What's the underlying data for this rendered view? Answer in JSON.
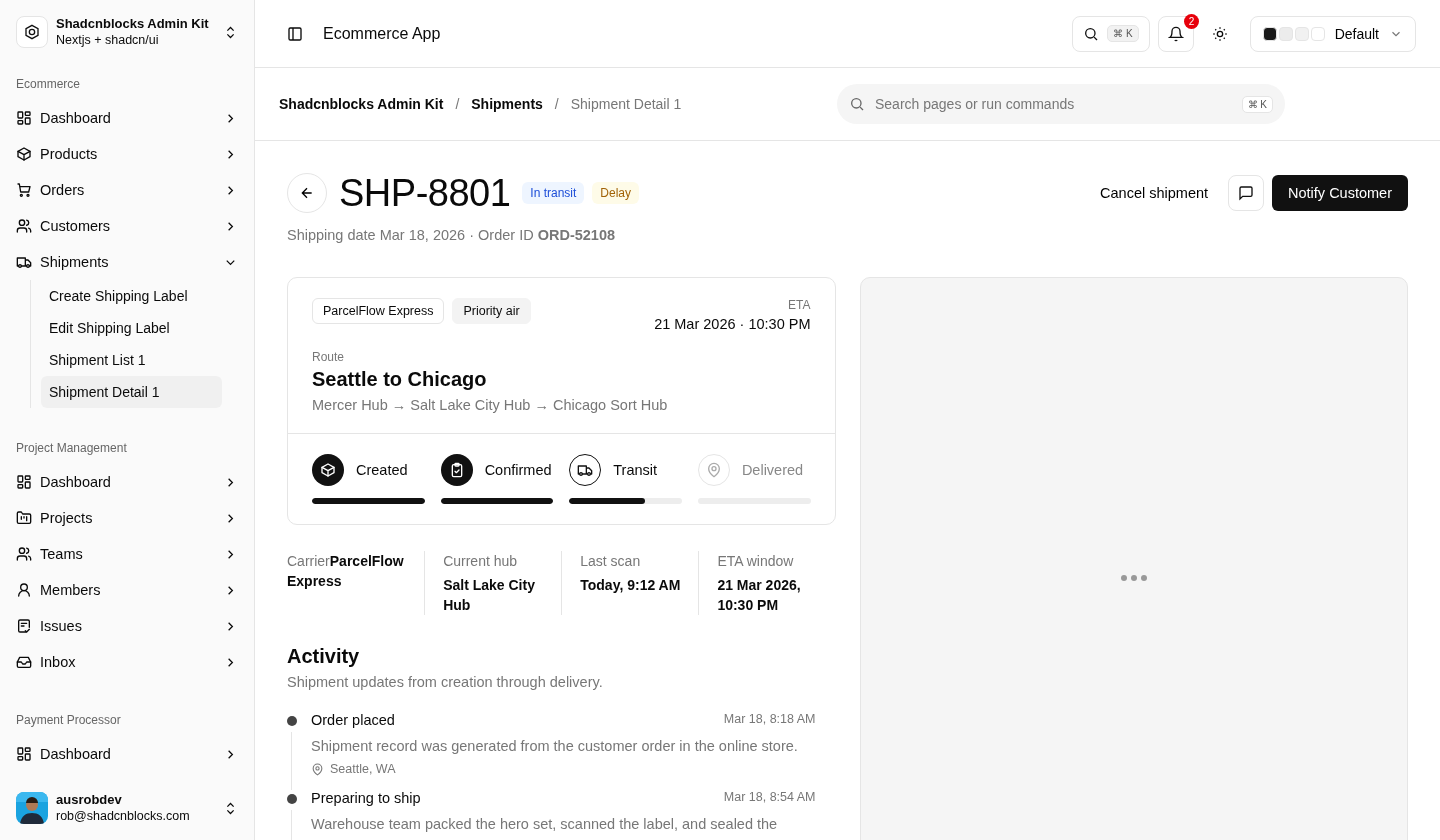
{
  "brand": {
    "name": "Shadcnblocks Admin Kit",
    "subtitle": "Nextjs + shadcn/ui"
  },
  "nav_groups": [
    {
      "label": "Ecommerce",
      "items": [
        {
          "label": "Dashboard",
          "expanded": false
        },
        {
          "label": "Products",
          "expanded": false
        },
        {
          "label": "Orders",
          "expanded": false
        },
        {
          "label": "Customers",
          "expanded": false
        },
        {
          "label": "Shipments",
          "expanded": true,
          "children": [
            {
              "label": "Create Shipping Label",
              "selected": false
            },
            {
              "label": "Edit Shipping Label",
              "selected": false
            },
            {
              "label": "Shipment List 1",
              "selected": false
            },
            {
              "label": "Shipment Detail 1",
              "selected": true
            }
          ]
        }
      ]
    },
    {
      "label": "Project Management",
      "items": [
        {
          "label": "Dashboard",
          "expanded": false
        },
        {
          "label": "Projects",
          "expanded": false
        },
        {
          "label": "Teams",
          "expanded": false
        },
        {
          "label": "Members",
          "expanded": false
        },
        {
          "label": "Issues",
          "expanded": false
        },
        {
          "label": "Inbox",
          "expanded": false
        }
      ]
    },
    {
      "label": "Payment Processor",
      "items": [
        {
          "label": "Dashboard",
          "expanded": false
        }
      ]
    }
  ],
  "user": {
    "name": "ausrobdev",
    "email": "rob@shadcnblocks.com"
  },
  "topbar": {
    "title": "Ecommerce App",
    "search_shortcut": "⌘ K",
    "notification_count": "2",
    "theme": "Default"
  },
  "breadcrumbs": {
    "separator": "/",
    "items": [
      {
        "label": "Shadcnblocks Admin Kit",
        "current": false
      },
      {
        "label": "Shipments",
        "current": false
      },
      {
        "label": "Shipment Detail 1",
        "current": true
      }
    ]
  },
  "command_search": {
    "placeholder": "Search pages or run commands",
    "shortcut": "⌘ K"
  },
  "shipment": {
    "id": "SHP-8801",
    "badges": [
      {
        "label": "In transit",
        "kind": "info"
      },
      {
        "label": "Delay",
        "kind": "warning"
      }
    ],
    "meta": "Shipping date Mar 18, 2026 · Order ID **ORD-52108**",
    "cancel_label": "Cancel shipment",
    "notify_label": "Notify Customer"
  },
  "route_card": {
    "tags": [
      {
        "label": "ParcelFlow Express",
        "kind": "outline"
      },
      {
        "label": "Priority air",
        "kind": "secondary"
      }
    ],
    "eta_label": "ETA",
    "eta": "21 Mar 2026 · 10:30 PM",
    "route_label": "Route",
    "route_title": "Seattle to Chicago",
    "route_path": "Mercer Hub → Salt Lake City Hub → Chicago Sort Hub",
    "steps": [
      {
        "label": "Created",
        "done": true,
        "level": 1
      },
      {
        "label": "Confirmed",
        "done": true,
        "level": 1
      },
      {
        "label": "Transit",
        "done": false,
        "level": 0.67
      },
      {
        "label": "Delivered",
        "done": false,
        "level": 0
      }
    ]
  },
  "stats": [
    {
      "label": "Carrier",
      "value": "ParcelFlow Express",
      "inline": true
    },
    {
      "label": "Current hub",
      "value": "Salt Lake City Hub",
      "inline": false
    },
    {
      "label": "Last scan",
      "value": "Today, 9:12 AM",
      "inline": false
    },
    {
      "label": "ETA window",
      "value": "21 Mar 2026, 10:30 PM",
      "inline": false
    }
  ],
  "activity": {
    "title": "Activity",
    "subtitle": "Shipment updates from creation through delivery.",
    "events": [
      {
        "title": "Order placed",
        "time": "Mar 18, 8:18 AM",
        "description": "Shipment record was generated from the customer order in the online store.",
        "location": "Seattle, WA"
      },
      {
        "title": "Preparing to ship",
        "time": "Mar 18, 8:54 AM",
        "description": "Warehouse team packed the hero set, scanned the label, and sealed the"
      }
    ]
  }
}
